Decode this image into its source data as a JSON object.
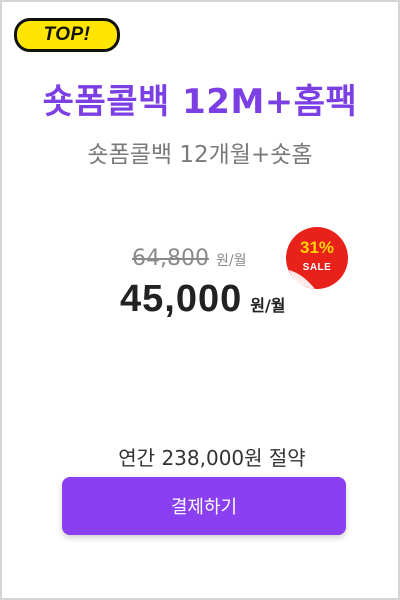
{
  "badge": {
    "label": "TOP!"
  },
  "product": {
    "title": "숏폼콜백 12M+홈팩",
    "subtitle": "숏폼콜백 12개월+숏홈"
  },
  "pricing": {
    "original_price": "64,800",
    "original_unit": "원/월",
    "price": "45,000",
    "price_unit": "원/월",
    "discount_percent": "31%",
    "sale_label": "SALE",
    "annual_savings": "연간 238,000원 절약"
  },
  "actions": {
    "pay_label": "결제하기"
  },
  "colors": {
    "accent": "#8a3ff0",
    "title": "#7b3fe4",
    "badge": "#ffe500",
    "sale": "#e8211b"
  }
}
